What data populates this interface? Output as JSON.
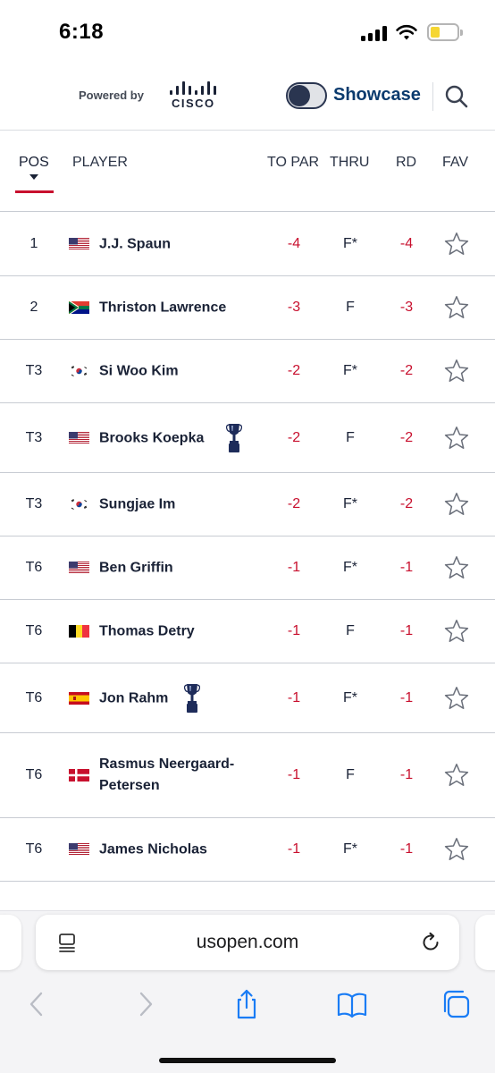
{
  "status": {
    "time": "6:18"
  },
  "header": {
    "powered_by": "Powered by",
    "sponsor": "CISCO",
    "showcase_label": "Showcase"
  },
  "columns": {
    "pos": "POS",
    "player": "PLAYER",
    "to_par": "TO PAR",
    "thru": "THRU",
    "rd": "RD",
    "fav": "FAV"
  },
  "players": [
    {
      "pos": "1",
      "flag": "usa",
      "name": "J.J. Spaun",
      "trophy": false,
      "to_par": "-4",
      "thru": "F*",
      "rd": "-4"
    },
    {
      "pos": "2",
      "flag": "rsa",
      "name": "Thriston Lawrence",
      "trophy": false,
      "to_par": "-3",
      "thru": "F",
      "rd": "-3"
    },
    {
      "pos": "T3",
      "flag": "kor",
      "name": "Si Woo Kim",
      "trophy": false,
      "to_par": "-2",
      "thru": "F*",
      "rd": "-2"
    },
    {
      "pos": "T3",
      "flag": "usa",
      "name": "Brooks Koepka",
      "trophy": true,
      "to_par": "-2",
      "thru": "F",
      "rd": "-2"
    },
    {
      "pos": "T3",
      "flag": "kor",
      "name": "Sungjae Im",
      "trophy": false,
      "to_par": "-2",
      "thru": "F*",
      "rd": "-2"
    },
    {
      "pos": "T6",
      "flag": "usa",
      "name": "Ben Griffin",
      "trophy": false,
      "to_par": "-1",
      "thru": "F*",
      "rd": "-1"
    },
    {
      "pos": "T6",
      "flag": "bel",
      "name": "Thomas Detry",
      "trophy": false,
      "to_par": "-1",
      "thru": "F",
      "rd": "-1"
    },
    {
      "pos": "T6",
      "flag": "esp",
      "name": "Jon Rahm",
      "trophy": true,
      "to_par": "-1",
      "thru": "F*",
      "rd": "-1"
    },
    {
      "pos": "T6",
      "flag": "den",
      "name": "Rasmus Neergaard-Petersen",
      "trophy": false,
      "to_par": "-1",
      "thru": "F",
      "rd": "-1"
    },
    {
      "pos": "T6",
      "flag": "usa",
      "name": "James Nicholas",
      "trophy": false,
      "to_par": "-1",
      "thru": "F*",
      "rd": "-1"
    }
  ],
  "browser": {
    "url": "usopen.com"
  },
  "colors": {
    "accent_red": "#c8102e",
    "navy": "#1a2236",
    "safari_blue": "#1a7cf5"
  }
}
